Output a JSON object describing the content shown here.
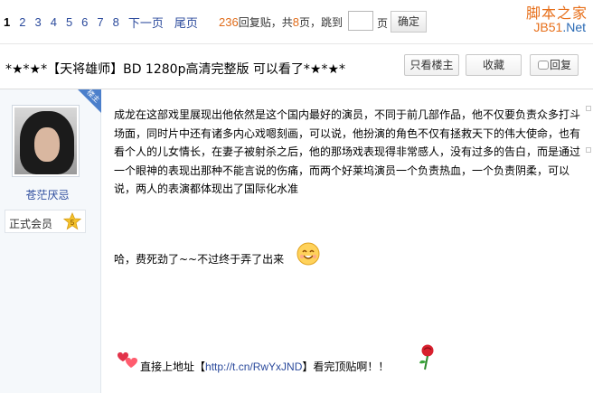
{
  "pager": {
    "current": "1",
    "pages": [
      "2",
      "3",
      "4",
      "5",
      "6",
      "7",
      "8"
    ],
    "next_label": "下一页",
    "last_label": "尾页",
    "reply_count": "236",
    "reply_text": "回复贴，共",
    "page_count": "8",
    "page_text": "页，跳到",
    "page_suffix": "页",
    "confirm_label": "确定"
  },
  "watermark": {
    "line1": "脚本之家",
    "line2_a": "JB51",
    "line2_b": ".Net"
  },
  "thread": {
    "title": "*★*★*【天将雄师】BD 1280p高清完整版 可以看了*★*★*",
    "only_op_label": "只看楼主",
    "favorite_label": "收藏",
    "reply_label": "回复"
  },
  "author": {
    "corner_badge": "楼主",
    "name": "苍茫厌忌",
    "rank": "正式会员",
    "rank_level": "5"
  },
  "post": {
    "paragraph": "成龙在这部戏里展现出他依然是这个国内最好的演员，不同于前几部作品，他不仅要负责众多打斗场面，同时片中还有诸多内心戏嗯刻画，可以说，他扮演的角色不仅有拯救天下的伟大使命，也有看个人的儿女情长，在妻子被射杀之后，他的那场戏表现得非常感人，没有过多的告白，而是通过一个眼神的表现出那种不能言说的伤痛，而两个好莱坞演员一个负责热血，一个负责阴柔，可以说，两人的表演都体现出了国际化水准",
    "line2": "哈，费死劲了~~不过终于弄了出来",
    "line3_prefix": "直接上地址【",
    "link_text": "http://t.cn/RwYxJND",
    "line3_suffix": "】看完顶贴啊！！"
  },
  "colors": {
    "link": "#2b4a9c",
    "accent": "#e06c1a",
    "corner": "#4b7fcb"
  },
  "icons": [
    "reply-bubble-icon",
    "smile-emoji-icon",
    "hearts-icon",
    "rose-icon",
    "level-star-icon"
  ]
}
